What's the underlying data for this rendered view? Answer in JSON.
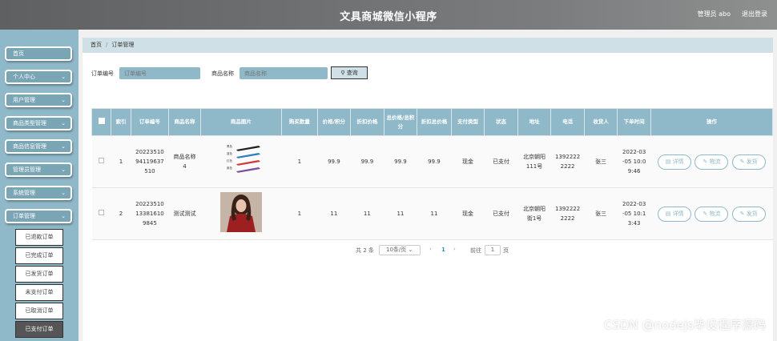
{
  "header": {
    "title": "文具商城微信小程序",
    "admin_label": "管理员 abo",
    "logout_label": "退出登录"
  },
  "sidebar": {
    "items": [
      {
        "label": "首页",
        "has_chevron": false
      },
      {
        "label": "个人中心",
        "has_chevron": true
      },
      {
        "label": "用户管理",
        "has_chevron": true
      },
      {
        "label": "商品类型管理",
        "has_chevron": true
      },
      {
        "label": "商品信息管理",
        "has_chevron": true
      },
      {
        "label": "管理员管理",
        "has_chevron": true
      },
      {
        "label": "系统管理",
        "has_chevron": true
      },
      {
        "label": "订单管理",
        "has_chevron": true
      }
    ],
    "chevron_glyph": "⌄",
    "submenu": [
      {
        "label": "已退款订单"
      },
      {
        "label": "已完成订单"
      },
      {
        "label": "已发货订单"
      },
      {
        "label": "未支付订单"
      },
      {
        "label": "已取消订单"
      },
      {
        "label": "已支付订单",
        "active": true
      }
    ]
  },
  "breadcrumb": {
    "home": "首页",
    "separator": "/",
    "current": "订单管理"
  },
  "search": {
    "order_no_label": "订单编号",
    "order_no_placeholder": "订单编号",
    "goods_name_label": "商品名称",
    "goods_name_placeholder": "商品名称",
    "button_label": "查询"
  },
  "table": {
    "columns": [
      "索引",
      "订单编号",
      "商品名称",
      "商品图片",
      "购买数量",
      "价格/积分",
      "折扣价格",
      "总价格/总积分",
      "折扣总价格",
      "支付类型",
      "状态",
      "地址",
      "电话",
      "收货人",
      "下单时间",
      "操作"
    ],
    "rows": [
      {
        "index": "1",
        "order_no": "20223510941196375l0",
        "order_no_display": [
          "20223510",
          "94119637",
          "510"
        ],
        "goods_name": [
          "商品名称",
          "4"
        ],
        "image": "pens",
        "qty": "1",
        "price": "99.9",
        "discount_price": "99.9",
        "total": "99.9",
        "discount_total": "99.9",
        "pay_type": "现金",
        "status": "已支付",
        "address": [
          "北京朝阳",
          "111号"
        ],
        "phone": [
          "1392222",
          "2222"
        ],
        "receiver": "张三",
        "time": [
          "2022-03",
          "-05 10:0",
          "9:46"
        ]
      },
      {
        "index": "2",
        "order_no_display": [
          "20223510",
          "13381610",
          "9845"
        ],
        "goods_name": [
          "测试测试"
        ],
        "image": "girl",
        "qty": "1",
        "price": "11",
        "discount_price": "11",
        "total": "11",
        "discount_total": "11",
        "pay_type": "现金",
        "status": "已支付",
        "address": [
          "北京朝阳",
          "街1号"
        ],
        "phone": [
          "1392222",
          "2222"
        ],
        "receiver": "张三",
        "time": [
          "2022-03",
          "-05 10:1",
          "3:43"
        ]
      }
    ],
    "actions": {
      "detail": "详情",
      "logistics": "物流",
      "ship": "发货"
    }
  },
  "pagination": {
    "total_text": "共 2 条",
    "page_size": "10条/页",
    "current_page": "1",
    "goto_label": "前往",
    "goto_value": "1",
    "page_suffix": "页"
  },
  "pen_labels": [
    "黑色",
    "蓝色",
    "红色",
    "紫色"
  ],
  "colors": {
    "accent": "#8fb8c9",
    "accent_dark": "#7aa5b5",
    "link": "#3a8fb5"
  },
  "watermark": "CSDN @nodejs毕设程序源码"
}
